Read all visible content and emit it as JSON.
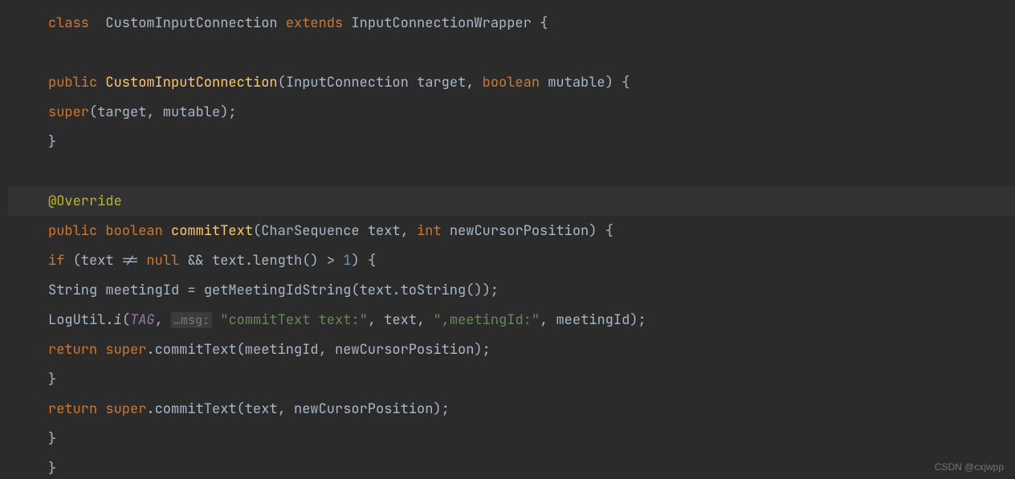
{
  "code": {
    "kw_class": "class ",
    "classname": " CustomInputConnection ",
    "kw_extends": "extends",
    "superclass": " InputConnectionWrapper ",
    "brace_open": "{",
    "brace_close": "}",
    "ctor_public": "public ",
    "ctor_name": "CustomInputConnection",
    "ctor_params_open": "(",
    "ctor_p1_type": "InputConnection ",
    "ctor_p1_name": "target",
    "ctor_comma": ", ",
    "ctor_p2_type": "boolean ",
    "ctor_p2_name": "mutable",
    "ctor_params_close": ") {",
    "ctor_super_kw": "super",
    "ctor_super_args": "(target, mutable);",
    "annot_override": "@Override",
    "m_public": "public ",
    "m_ret": "boolean ",
    "m_name": "commitText",
    "m_params_open": "(",
    "m_p1_type": "CharSequence ",
    "m_p1_name": "text",
    "m_comma": ", ",
    "m_p2_type": "int ",
    "m_p2_name": "newCursorPosition",
    "m_params_close": ") {",
    "if_kw": "if ",
    "if_cond_open": "(text != ",
    "if_null": "null",
    "if_cond_mid": " && text.length() > ",
    "if_num": "1",
    "if_cond_close": ") {",
    "l1_type": "String ",
    "l1_name": "meetingId = ",
    "l1_call": "getMeetingIdString(text.toString());",
    "log_prefix": "LogUtil.",
    "log_method": "i",
    "log_open": "(",
    "log_tag": "TAG",
    "log_comma1": ", ",
    "log_hint": "…msg:",
    "log_s1": " \"commitText text:\"",
    "log_mid1": ", text, ",
    "log_s2": "\",meetingId:\"",
    "log_mid2": ", meetingId);",
    "ret1_kw": "return ",
    "ret1_super": "super",
    "ret1_rest": ".commitText(meetingId, newCursorPosition);",
    "ret2_kw": "return ",
    "ret2_super": "super",
    "ret2_rest": ".commitText(text, newCursorPosition);"
  },
  "watermark": "CSDN @cxjwpp"
}
